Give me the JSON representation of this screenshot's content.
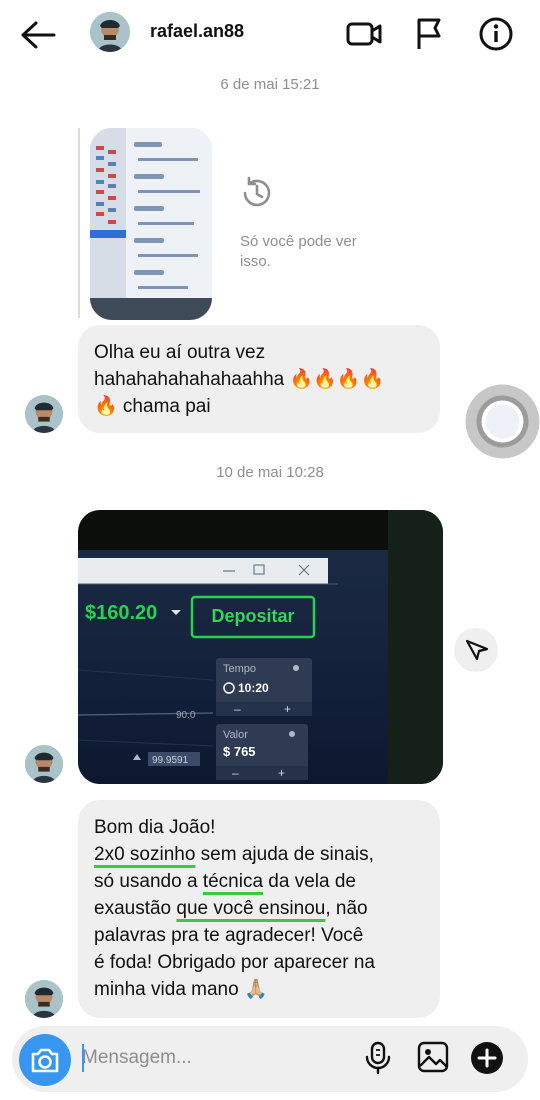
{
  "header": {
    "username": "rafael.an88",
    "icons": [
      "back-arrow-icon",
      "video-call-icon",
      "flag-icon",
      "info-icon"
    ]
  },
  "messages": {
    "timestamp_1": "6 de mai 15:21",
    "expired_note": "Só você pode ver isso.",
    "bubble_1": {
      "line1": "Olha eu aí outra vez",
      "line2": "hahahahahahahaahha 🔥🔥🔥🔥",
      "line3": "🔥 chama pai"
    },
    "timestamp_2": "10 de mai 10:28",
    "photo_2": {
      "balance": "$160.20",
      "deposit_label": "Depositar",
      "time_label": "Tempo",
      "time_value": "10:20",
      "value_label": "Valor",
      "value_amount": "$ 765",
      "chart_level": "90.0",
      "price_tag": "99.9591"
    },
    "bubble_2": {
      "line1": "Bom dia João!",
      "line2_u": "2x0 sozinho",
      "line2_rest": " sem ajuda de sinais,",
      "line3_pre": "só usando a ",
      "line3_u": "técnica",
      "line3_rest": " da vela de",
      "line4_pre": "exaustão ",
      "line4_u": "que você ensinou",
      "line4_rest": ", não",
      "line5": "palavras pra te agradecer! Você",
      "line6": "é foda! Obrigado por aparecer na",
      "line7": "minha vida mano 🙏🏼"
    }
  },
  "composer": {
    "placeholder": "Mensagem...",
    "icons": [
      "camera-icon",
      "microphone-icon",
      "gallery-icon",
      "plus-icon"
    ]
  },
  "colors": {
    "accent": "#3797f0",
    "bubble": "#efefef",
    "timestamp": "#8e8e8e",
    "underline": "#3ac943",
    "balance_green": "#27d34c"
  }
}
